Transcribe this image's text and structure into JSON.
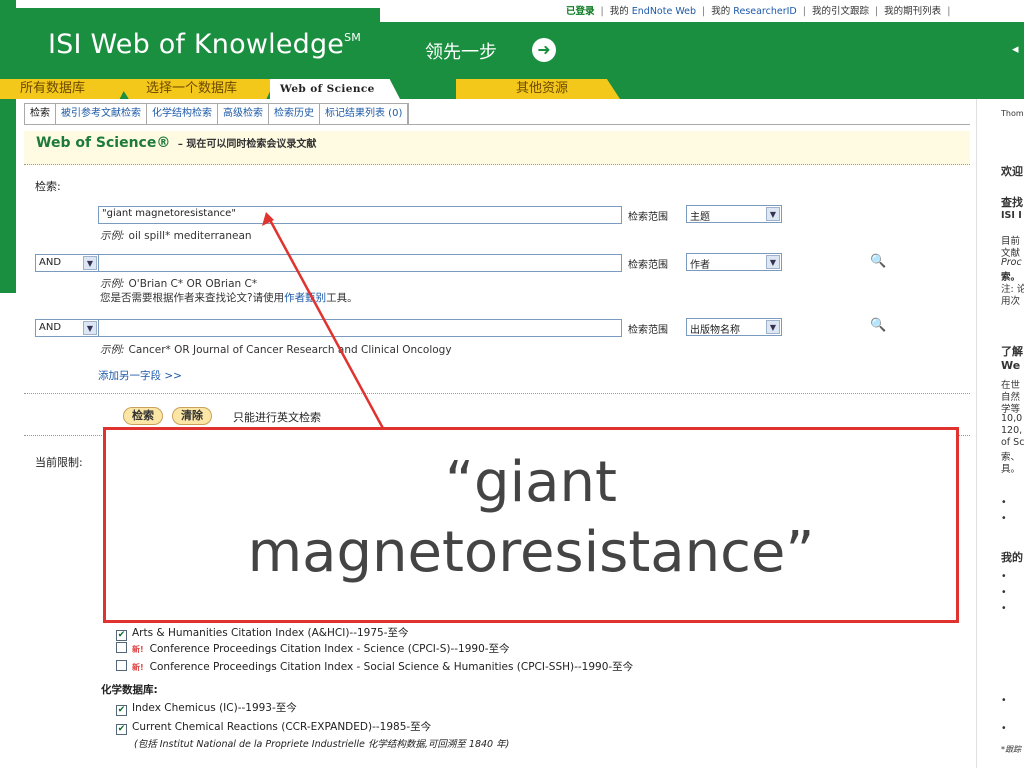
{
  "util_bar": {
    "login": "已登录",
    "my_endnote_prefix": "我的",
    "my_endnote": "EndNote Web",
    "my_rid_prefix": "我的",
    "my_rid": "ResearcherID",
    "citation_alert": "我的引文跟踪",
    "journal_list": "我的期刊列表"
  },
  "header": {
    "brand": "ISI Web of Knowledge",
    "brand_mark": "SM",
    "slogan": "领先一步",
    "slogan_icon": "go-arrow-icon"
  },
  "main_tabs": [
    {
      "label": "所有数据库"
    },
    {
      "label": "选择一个数据库"
    },
    {
      "label": "Web of Science"
    },
    {
      "label": "其他资源"
    }
  ],
  "sub_tabs": [
    {
      "label": "检索"
    },
    {
      "label": "被引参考文献检索"
    },
    {
      "label": "化学结构检索"
    },
    {
      "label": "高级检索"
    },
    {
      "label": "检索历史"
    },
    {
      "label": "标记结果列表 (0)"
    }
  ],
  "title": {
    "main": "Web of Science®",
    "sub": "– 现在可以同时检索会议录文献"
  },
  "search": {
    "label": "检索:",
    "row1": {
      "value": "\"giant magnetoresistance\"",
      "example_prefix": "示例:",
      "example": "oil spill* mediterranean",
      "scope_label": "检索范围",
      "scope": "主题"
    },
    "row2": {
      "op": "AND",
      "value": "",
      "example_prefix": "示例:",
      "example": "O'Brian C* OR OBrian C*",
      "hint_pre": "您是否需要根据作者来查找论文?请使用",
      "hint_link": "作者甄别",
      "hint_post": "工具。",
      "scope_label": "检索范围",
      "scope": "作者"
    },
    "row3": {
      "op": "AND",
      "value": "",
      "example_prefix": "示例:",
      "example": "Cancer* OR Journal of Cancer Research and Clinical Oncology",
      "scope_label": "检索范围",
      "scope": "出版物名称"
    },
    "add_field": "添加另一字段 >>",
    "search_btn": "检索",
    "clear_btn": "清除",
    "english_only": "只能进行英文检索"
  },
  "limits": {
    "label": "当前限制:"
  },
  "databases": {
    "rows": [
      {
        "checked": true,
        "new": false,
        "label": "Arts & Humanities Citation Index (A&HCI)--1975-至今"
      },
      {
        "checked": false,
        "new": true,
        "label": "Conference Proceedings Citation Index - Science (CPCI-S)--1990-至今"
      },
      {
        "checked": false,
        "new": true,
        "label": "Conference Proceedings Citation Index - Social Science & Humanities (CPCI-SSH)--1990-至今"
      }
    ],
    "chem_heading": "化学数据库:",
    "chem_rows": [
      {
        "checked": true,
        "label": "Index Chemicus (IC)--1993-至今"
      },
      {
        "checked": true,
        "label": "Current Chemical Reactions (CCR-EXPANDED)--1985-至今"
      }
    ],
    "chem_note": "(包括 Institut National de la Propriete Industrielle 化学结构数据,可回溯至 1840 年)",
    "new_badge": "新!"
  },
  "sidebar": {
    "thom": "Thom",
    "welcome": "欢迎",
    "find": "查找",
    "isi": "ISI I",
    "l1": "目前",
    "l2": "文献",
    "l3": "Proc",
    "l4": "索。",
    "l5": "注: 论",
    "l6": "用次",
    "learn": "了解",
    "we": "We",
    "p1": "在世",
    "p2": "自然",
    "p3": "学等",
    "p4": "10,0",
    "p5": "120,",
    "p6": "of Sc",
    "p7": "索、",
    "p8": "具。",
    "mine": "我的",
    "foot": "*跟踪"
  },
  "callout": {
    "line1": "“giant",
    "line2": "magnetoresistance”"
  },
  "colors": {
    "brand_green": "#1a8f3f",
    "tab_yellow": "#f4c81b",
    "callout_red": "#e0322e",
    "link_blue": "#1d5aa8"
  }
}
